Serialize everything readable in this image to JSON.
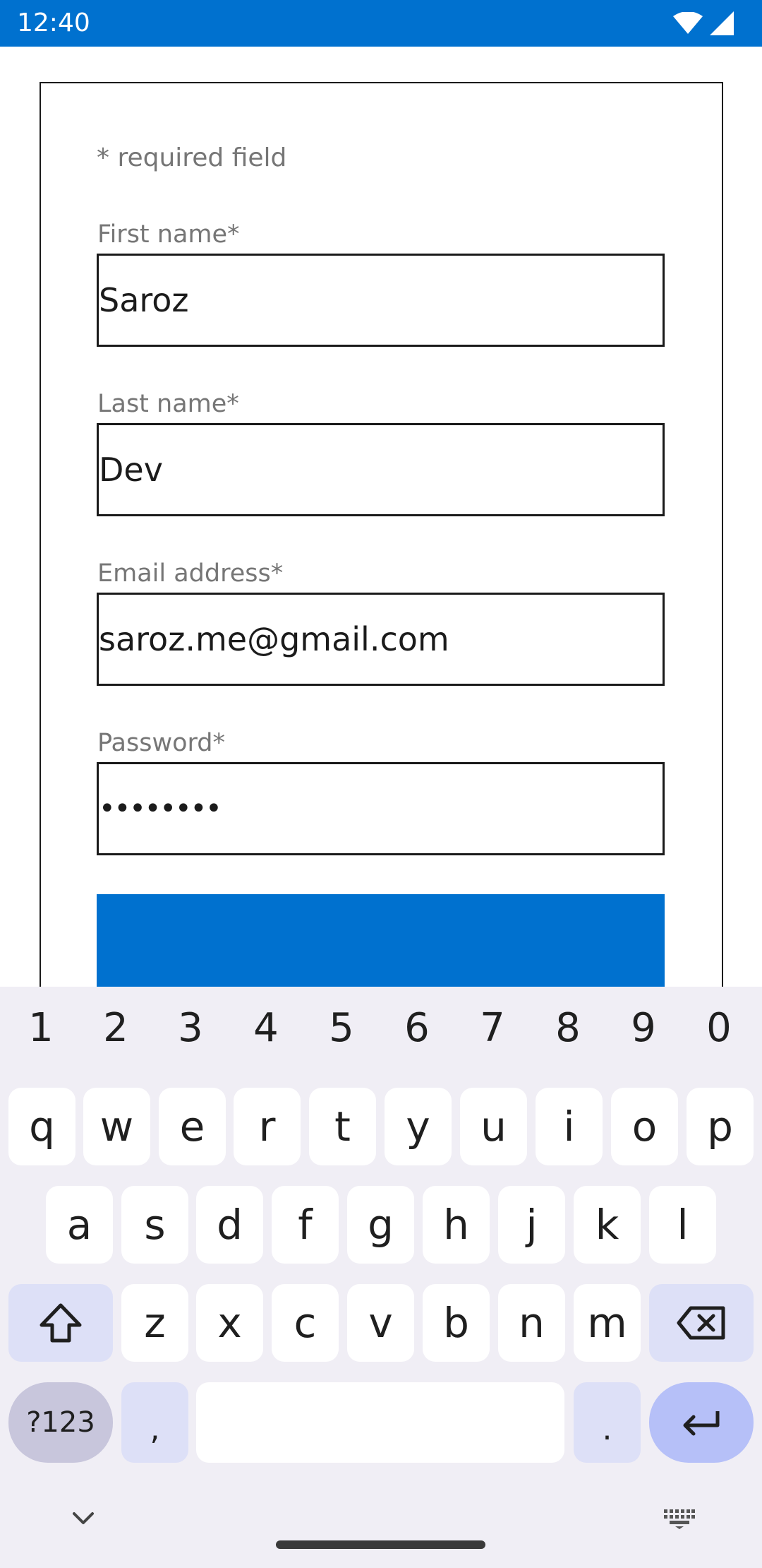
{
  "status_bar": {
    "time": "12:40",
    "wifi_icon": "wifi-icon",
    "signal_icon": "signal-icon"
  },
  "form": {
    "required_note": "* required field",
    "fields": [
      {
        "label": "First name*",
        "value": "Saroz"
      },
      {
        "label": "Last name*",
        "value": "Dev"
      },
      {
        "label": "Email address*",
        "value": "saroz.me@gmail.com"
      },
      {
        "label": "Password*",
        "value": "••••••••"
      }
    ],
    "colors": {
      "accent": "#0071cf",
      "label_gray": "#767676",
      "border": "#1a1a1a"
    }
  },
  "keyboard": {
    "number_row": [
      "1",
      "2",
      "3",
      "4",
      "5",
      "6",
      "7",
      "8",
      "9",
      "0"
    ],
    "row1": [
      "q",
      "w",
      "e",
      "r",
      "t",
      "y",
      "u",
      "i",
      "o",
      "p"
    ],
    "row2": [
      "a",
      "s",
      "d",
      "f",
      "g",
      "h",
      "j",
      "k",
      "l"
    ],
    "row3": [
      "z",
      "x",
      "c",
      "v",
      "b",
      "n",
      "m"
    ],
    "symbols_key": "?123",
    "comma_key": ",",
    "period_key": ".",
    "icons": {
      "shift": "shift-icon",
      "backspace": "backspace-icon",
      "enter": "enter-icon",
      "collapse": "chevron-down-icon",
      "switch_keyboard": "keyboard-icon"
    }
  }
}
